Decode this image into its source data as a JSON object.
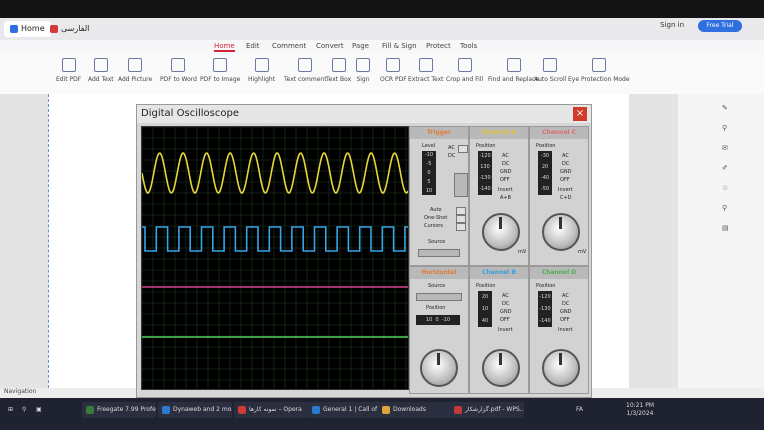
{
  "window": {
    "tabs": [
      {
        "label": "Home"
      },
      {
        "label": "الفارسی"
      }
    ],
    "account_label": "Sign in",
    "free_trial_label": "Free Trial"
  },
  "menus": [
    "Home",
    "Edit",
    "Comment",
    "Convert",
    "Page",
    "Fill & Sign",
    "Protect",
    "Tools"
  ],
  "ribbon": [
    "Edit PDF",
    "Add Text",
    "Add Picture",
    "PDF to Word",
    "PDF to Image",
    "Highlight",
    "Text comment",
    "Text Box",
    "Sign",
    "OCR PDF",
    "Extract Text",
    "Crop and Fill",
    "Find and Replace",
    "Auto Scroll",
    "Eye Protection Mode"
  ],
  "oscilloscope": {
    "title": "Digital Oscilloscope",
    "close_label": "×",
    "trigger": {
      "title": "Trigger",
      "level_label": "Level",
      "ac": "AC",
      "dc": "DC",
      "auto": "Auto",
      "one_shot": "One-Shot",
      "cursors": "Cursors",
      "source": "Source",
      "lcd": [
        "-10",
        "-5",
        "0",
        "5",
        "10"
      ]
    },
    "channel_a": {
      "title": "Channel A",
      "position": "Position",
      "ac": "AC",
      "dc": "DC",
      "gnd": "GND",
      "off": "OFF",
      "invert": "Invert",
      "ab": "A+B",
      "lcd": [
        "-120",
        "130",
        "-130",
        "-140"
      ],
      "unit": "mV"
    },
    "channel_c": {
      "title": "Channel C",
      "position": "Position",
      "ac": "AC",
      "dc": "DC",
      "gnd": "GND",
      "off": "OFF",
      "invert": "Invert",
      "cd": "C+D",
      "lcd": [
        "-30",
        "20",
        "-40",
        "-50"
      ],
      "unit": "mV"
    },
    "horizontal": {
      "title": "Horizontal",
      "source": "Source",
      "position": "Position",
      "lcd": [
        "10",
        "0",
        "-10"
      ]
    },
    "channel_b": {
      "title": "Channel B",
      "position": "Position",
      "ac": "AC",
      "dc": "DC",
      "gnd": "GND",
      "off": "OFF",
      "invert": "Invert",
      "lcd": [
        "20",
        "10",
        "40"
      ]
    },
    "channel_d": {
      "title": "Channel D",
      "position": "Position",
      "ac": "AC",
      "dc": "DC",
      "gnd": "GND",
      "off": "OFF",
      "invert": "Invert",
      "lcd": [
        "-120",
        "-130",
        "-140"
      ]
    },
    "colors": {
      "yellow": "#e5d63a",
      "blue": "#35a4e8",
      "pink": "#d8408f",
      "green": "#4fd05a",
      "trigger_head": "#e07c3a",
      "ch_a_head": "#e0c13a",
      "ch_c_head": "#e06a6a",
      "ch_b_head": "#3aa0e0",
      "ch_d_head": "#4fb04f"
    }
  },
  "navigation_label": "Navigation",
  "taskbar": {
    "items": [
      "Freegate 7.99 Profe...",
      "Dynaweb and 2 mo...",
      "نمونه کارها – Opera",
      "General 1 | Call of T...",
      "Downloads",
      "گزارشکار.pdf - WPS..."
    ],
    "time": "10:21 PM",
    "date": "1/3/2024",
    "lang": "FA"
  }
}
